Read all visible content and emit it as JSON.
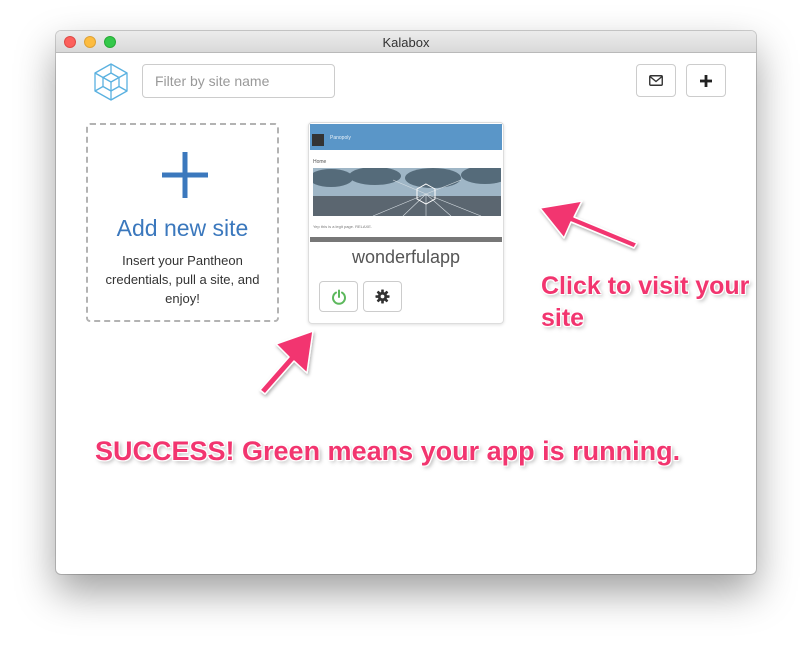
{
  "window": {
    "title": "Kalabox"
  },
  "toolbar": {
    "logo_icon": "kalabox-cube-logo-icon",
    "search_placeholder": "Filter by site name",
    "mail_icon": "envelope-icon",
    "add_icon": "plus-icon"
  },
  "add_site_card": {
    "title": "Add new site",
    "description": "Insert your Pantheon credentials, pull a site, and enjoy!",
    "icon": "plus-icon"
  },
  "site_card": {
    "name": "wonderfulapp",
    "thumbnail": {
      "brand": "Panopoly",
      "nav_home": "Home",
      "body_text": "Yep this is a legit page. RELAXE."
    },
    "power_icon": "power-icon",
    "settings_icon": "gear-icon",
    "status_color": "#5cb85c"
  },
  "annotations": {
    "visit_text": "Click to visit your site",
    "success_text": "SUCCESS! Green means your app is running.",
    "color": "#f2356f"
  },
  "colors": {
    "accent": "#3b78bd",
    "logo": "#5ab1e0"
  }
}
